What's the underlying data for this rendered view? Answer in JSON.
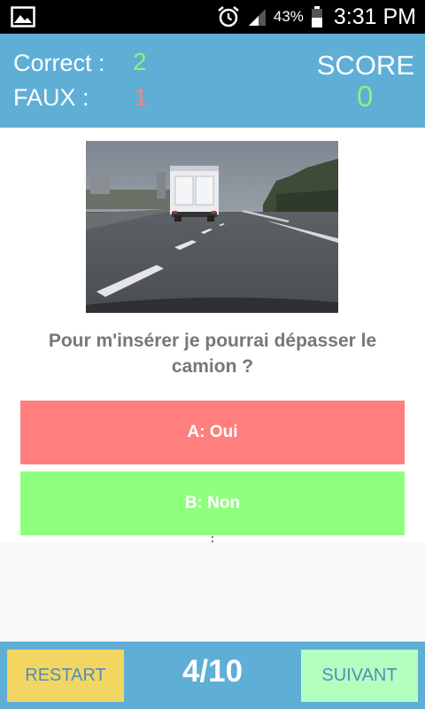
{
  "status_bar": {
    "battery_percent": "43%",
    "time": "3:31 PM",
    "icons": [
      "gallery-icon",
      "alarm-icon",
      "signal-icon",
      "battery-icon"
    ]
  },
  "header": {
    "correct_label": "Correct :",
    "correct_value": "2",
    "faux_label": "FAUX :",
    "faux_value": "1",
    "score_label": "SCORE",
    "score_value": "0"
  },
  "question": {
    "text": "Pour m'insérer je pourrai dépasser le camion ?",
    "image_description_icon": "road-truck-photo"
  },
  "answers": [
    {
      "label": "A: Oui",
      "color": "#ff7e7e"
    },
    {
      "label": "B: Non",
      "color": "#8fff7e"
    }
  ],
  "footer": {
    "restart_label": "RESTART",
    "progress": "4/10",
    "suivant_label": "SUIVANT"
  },
  "colors": {
    "header_bg": "#5eaed6",
    "correct_value": "#8ff07a",
    "faux_value": "#f08586",
    "restart_bg": "#f3d562",
    "suivant_bg": "#b3ffbf"
  }
}
